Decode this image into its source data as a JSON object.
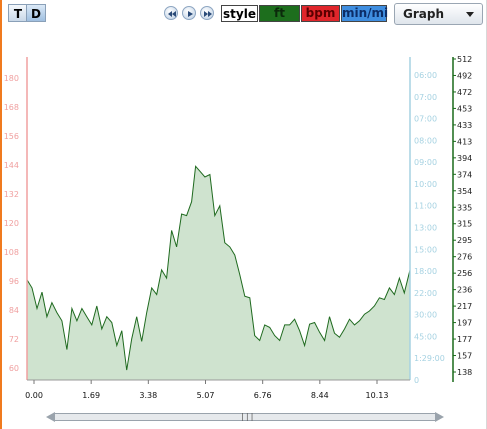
{
  "toolbar": {
    "t_label": "T",
    "d_label": "D",
    "style_label": "style",
    "ft_label": "ft",
    "bpm_label": "bpm",
    "pace_label": "min/mi",
    "view_select": "Graph"
  },
  "colors": {
    "elevation_fill": "#cfe3cf",
    "elevation_line": "#1f6a1f",
    "hr_axis": "#f0a0a0",
    "pace_axis": "#a6d2e2",
    "elev_axis": "#1a6a1a",
    "ft_button": "#1d6e1d",
    "bpm_button": "#e0262b",
    "pace_button": "#3f8ee0"
  },
  "chart_data": {
    "type": "area",
    "x_ticks": [
      "0.00",
      "1.69",
      "3.38",
      "5.07",
      "6.76",
      "8.44",
      "10.13"
    ],
    "xlim": [
      0,
      11.52
    ],
    "hr_axis_ticks": [
      "180",
      "168",
      "156",
      "144",
      "132",
      "120",
      "108",
      "96",
      "84",
      "72",
      "60"
    ],
    "pace_axis_ticks": [
      "06:00",
      "07:00",
      "07:00",
      "08:00",
      "09:00",
      "10:00",
      "11:00",
      "13:00",
      "15:00",
      "18:00",
      "22:00",
      "30:00",
      "45:00",
      "1:29:00",
      "0"
    ],
    "elevation_axis_ticks": [
      "512",
      "492",
      "472",
      "453",
      "433",
      "413",
      "394",
      "374",
      "354",
      "335",
      "315",
      "295",
      "276",
      "256",
      "236",
      "217",
      "197",
      "177",
      "157",
      "138"
    ],
    "ylim_ft": [
      128,
      521
    ],
    "series": [
      {
        "name": "ft",
        "x": [
          0,
          0.15,
          0.3,
          0.45,
          0.6,
          0.75,
          0.9,
          1.05,
          1.2,
          1.35,
          1.5,
          1.65,
          1.8,
          1.95,
          2.1,
          2.25,
          2.4,
          2.55,
          2.7,
          2.85,
          3.0,
          3.15,
          3.3,
          3.45,
          3.6,
          3.75,
          3.9,
          4.05,
          4.2,
          4.35,
          4.5,
          4.65,
          4.8,
          4.95,
          5.07,
          5.2,
          5.35,
          5.5,
          5.65,
          5.8,
          5.95,
          6.1,
          6.25,
          6.4,
          6.55,
          6.7,
          6.85,
          7.0,
          7.15,
          7.3,
          7.45,
          7.6,
          7.75,
          7.9,
          8.05,
          8.2,
          8.35,
          8.5,
          8.65,
          8.8,
          8.95,
          9.1,
          9.25,
          9.4,
          9.55,
          9.7,
          9.85,
          10.0,
          10.15,
          10.3,
          10.45,
          10.6,
          10.75,
          10.9,
          11.05,
          11.2,
          11.35,
          11.52
        ],
        "y": [
          250,
          240,
          215,
          235,
          205,
          222,
          210,
          200,
          165,
          215,
          200,
          215,
          205,
          195,
          218,
          190,
          205,
          198,
          170,
          188,
          140,
          178,
          205,
          175,
          210,
          240,
          232,
          262,
          252,
          310,
          290,
          330,
          328,
          345,
          388,
          382,
          375,
          378,
          328,
          340,
          295,
          290,
          280,
          256,
          230,
          228,
          182,
          176,
          195,
          192,
          182,
          176,
          195,
          195,
          202,
          188,
          170,
          196,
          198,
          186,
          176,
          205,
          185,
          180,
          190,
          202,
          195,
          200,
          208,
          212,
          218,
          228,
          226,
          240,
          232,
          252,
          234,
          262
        ]
      }
    ]
  },
  "scrollbar": {
    "grip": "|||"
  }
}
